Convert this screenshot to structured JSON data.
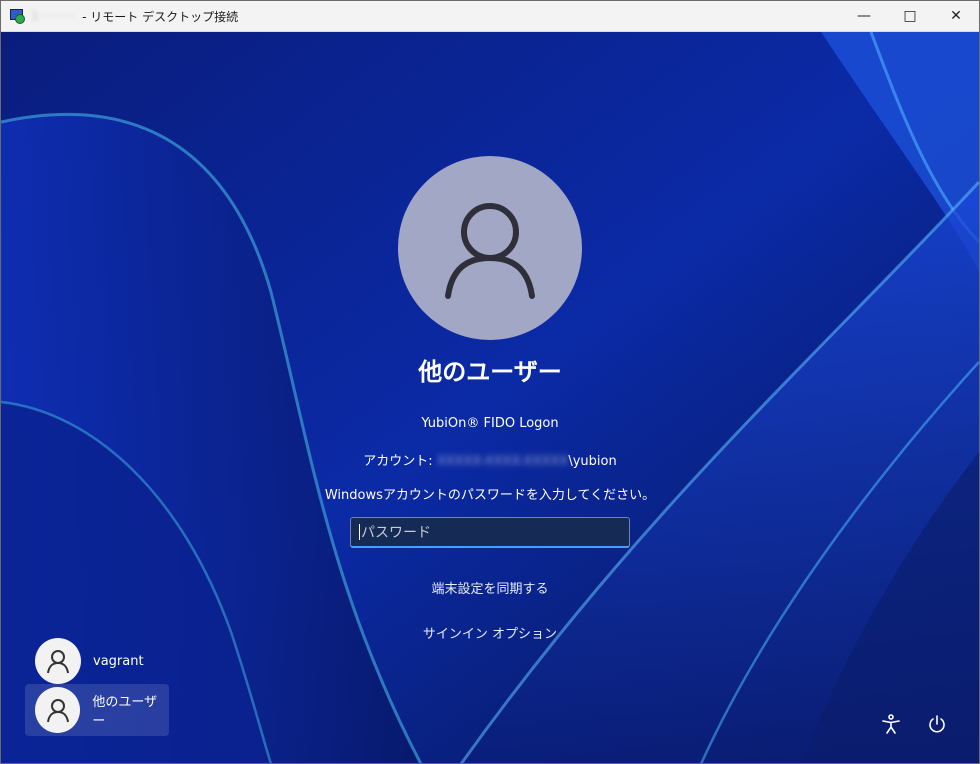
{
  "window": {
    "host_blurred": "1········",
    "title": "- リモート デスクトップ接続",
    "controls": {
      "minimize": "—",
      "maximize": "□",
      "close": "✕"
    }
  },
  "login": {
    "user_name": "他のユーザー",
    "provider": "YubiOn® FIDO Logon",
    "account_label": "アカウント:",
    "account_domain_blurred": "XXXXX-XXXX-XXXXX",
    "account_user": "\\yubion",
    "prompt": "Windowsアカウントのパスワードを入力してください。",
    "password_placeholder": "パスワード",
    "sync_link": "端末設定を同期する",
    "signin_options_link": "サインイン オプション"
  },
  "users": [
    {
      "label": "vagrant",
      "icon": "user-icon",
      "selected": false
    },
    {
      "label": "他のユーザー",
      "icon": "user-icon",
      "selected": true
    }
  ],
  "bottom_icons": [
    "accessibility-icon",
    "power-icon"
  ],
  "colors": {
    "accent": "#4a9cff",
    "background": "#0b1f7a",
    "avatar": "#a3a7c6"
  }
}
